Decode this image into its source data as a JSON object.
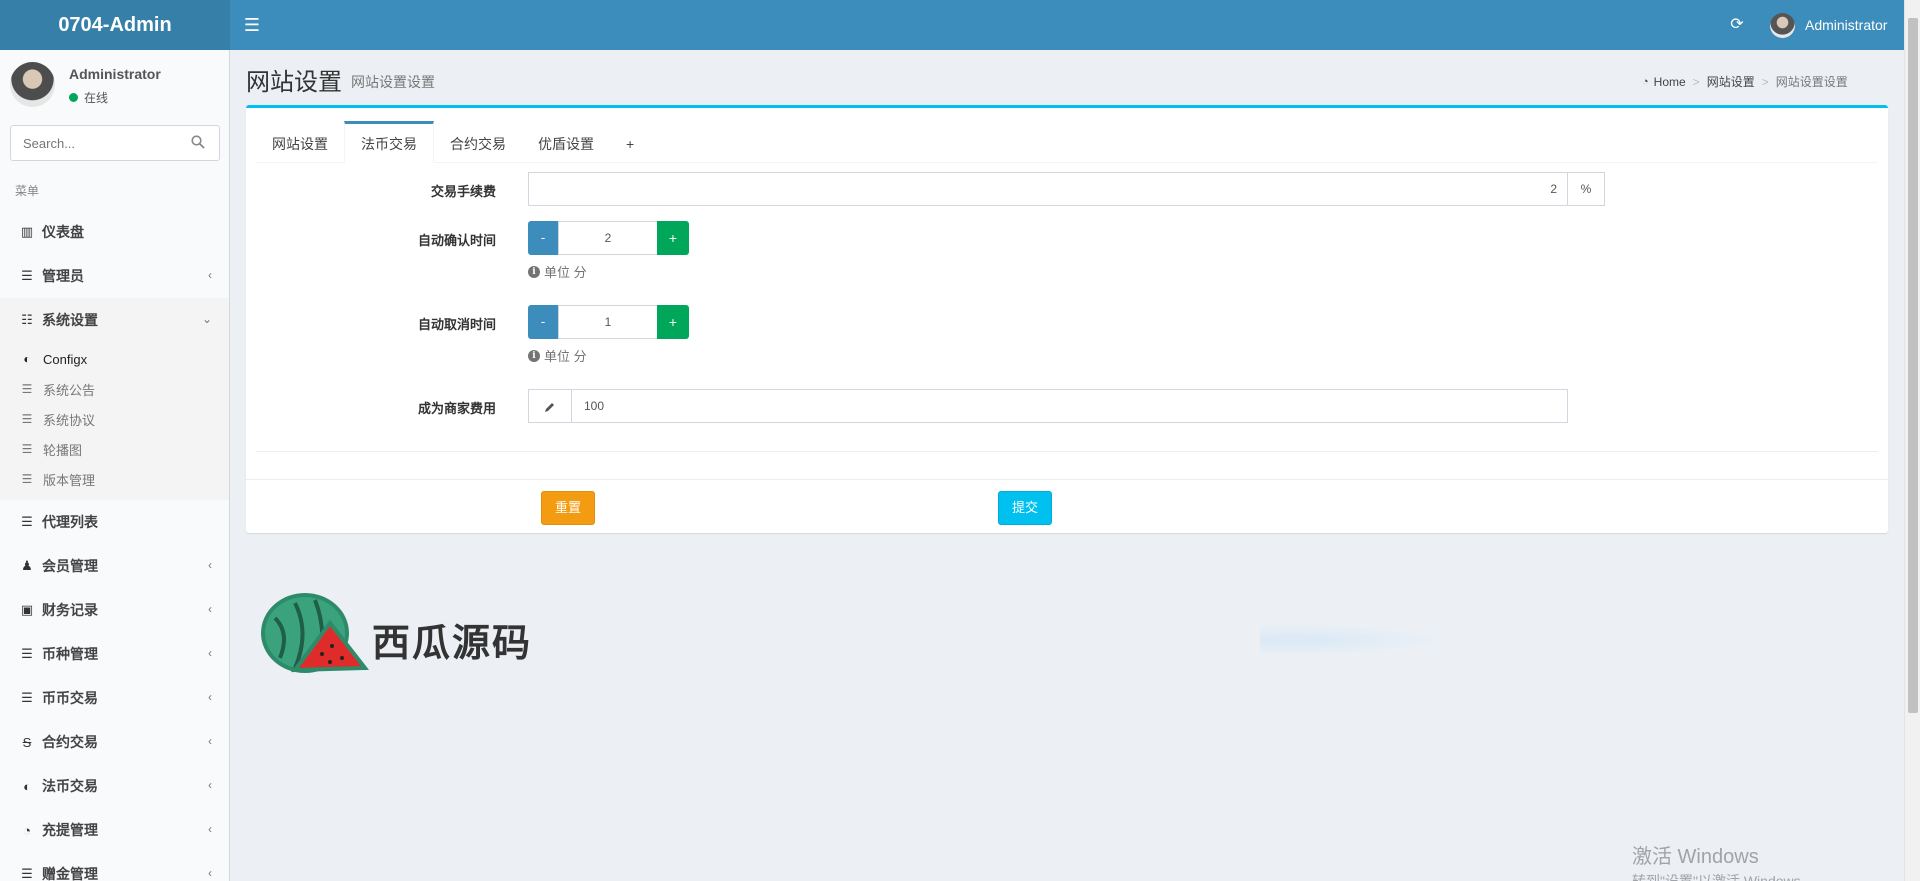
{
  "app": {
    "title": "0704-Admin",
    "user": "Administrator"
  },
  "topbar": {
    "toggle_icon": "☰",
    "refresh_icon": "⟳"
  },
  "sidebar": {
    "user": {
      "name": "Administrator",
      "status": "在线"
    },
    "search": {
      "placeholder": "Search..."
    },
    "header": "菜单",
    "items": [
      {
        "label": "仪表盘",
        "icon": "bar-chart-icon",
        "glyph": "▥",
        "has_children": false
      },
      {
        "label": "管理员",
        "icon": "list-icon",
        "glyph": "☰",
        "has_children": true
      },
      {
        "label": "系统设置",
        "icon": "sliders-icon",
        "glyph": "☷",
        "has_children": true,
        "open": true
      },
      {
        "label": "代理列表",
        "icon": "list-icon",
        "glyph": "☰",
        "has_children": false
      },
      {
        "label": "会员管理",
        "icon": "users-icon",
        "glyph": "♟",
        "has_children": true
      },
      {
        "label": "财务记录",
        "icon": "money-icon",
        "glyph": "▣",
        "has_children": true
      },
      {
        "label": "币种管理",
        "icon": "list-icon",
        "glyph": "☰",
        "has_children": true
      },
      {
        "label": "币币交易",
        "icon": "list-icon",
        "glyph": "☰",
        "has_children": true
      },
      {
        "label": "合约交易",
        "icon": "strikethrough-icon",
        "glyph": "S",
        "has_children": true
      },
      {
        "label": "法币交易",
        "icon": "adjust-icon",
        "glyph": "◐",
        "has_children": true
      },
      {
        "label": "充提管理",
        "icon": "dashboard-icon",
        "glyph": "◔",
        "has_children": true
      },
      {
        "label": "赠金管理",
        "icon": "list-icon",
        "glyph": "☰",
        "has_children": true
      }
    ],
    "subitems": [
      {
        "label": "Configx",
        "icon": "toggle-icon",
        "glyph": "◐",
        "active": true
      },
      {
        "label": "系统公告",
        "icon": "list-icon",
        "glyph": "☰",
        "active": false
      },
      {
        "label": "系统协议",
        "icon": "list-icon",
        "glyph": "☰",
        "active": false
      },
      {
        "label": "轮播图",
        "icon": "list-icon",
        "glyph": "☰",
        "active": false
      },
      {
        "label": "版本管理",
        "icon": "list-icon",
        "glyph": "☰",
        "active": false
      }
    ]
  },
  "content": {
    "title": "网站设置",
    "subtitle": "网站设置设置",
    "breadcrumb": [
      "Home",
      "网站设置",
      "网站设置设置"
    ]
  },
  "tabs": [
    {
      "label": "网站设置",
      "active": false
    },
    {
      "label": "法币交易",
      "active": true
    },
    {
      "label": "合约交易",
      "active": false
    },
    {
      "label": "优盾设置",
      "active": false
    },
    {
      "label": "+",
      "active": false
    }
  ],
  "form": {
    "fee": {
      "label": "交易手续费",
      "value": "2",
      "unit": "%"
    },
    "auto_confirm": {
      "label": "自动确认时间",
      "value": "2",
      "minus": "-",
      "plus": "+",
      "hint": "单位 分"
    },
    "auto_cancel": {
      "label": "自动取消时间",
      "value": "1",
      "minus": "-",
      "plus": "+",
      "hint": "单位 分"
    },
    "merchant_fee": {
      "label": "成为商家费用",
      "value": "100"
    },
    "reset_label": "重置",
    "submit_label": "提交"
  },
  "watermark": {
    "text": "西瓜源码"
  },
  "windows_activation": {
    "line1": "激活 Windows",
    "line2": "转到\"设置\"以激活 Windows。"
  },
  "colors": {
    "primary": "#3c8dbc",
    "logo_bg": "#367fa9",
    "success": "#00a65a",
    "warning": "#f39c12",
    "info": "#00c0ef"
  }
}
